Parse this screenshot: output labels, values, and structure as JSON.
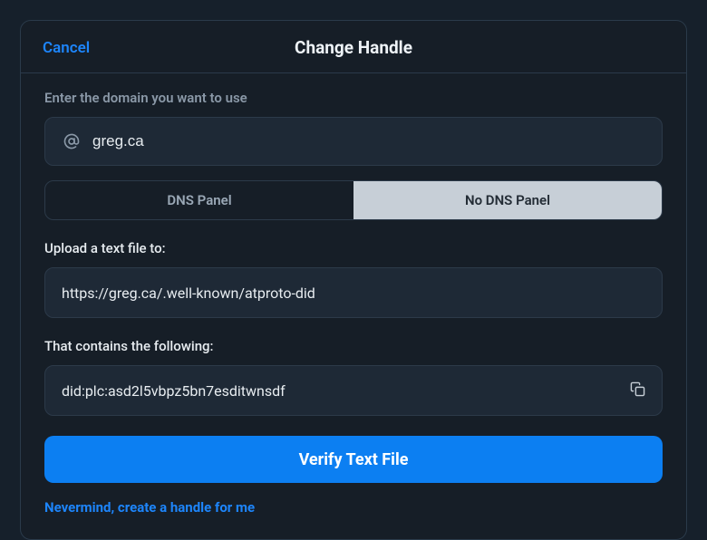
{
  "modal": {
    "cancel": "Cancel",
    "title": "Change Handle",
    "domain_label": "Enter the domain you want to use",
    "domain_value": "greg.ca",
    "tabs": {
      "dns": "DNS Panel",
      "no_dns": "No DNS Panel"
    },
    "upload_label": "Upload a text file to:",
    "upload_url": "https://greg.ca/.well-known/atproto-did",
    "contents_label": "That contains the following:",
    "contents_value": "did:plc:asd2l5vbpz5bn7esditwnsdf",
    "verify_btn": "Verify Text File",
    "footer_link": "Nevermind, create a handle for me"
  }
}
